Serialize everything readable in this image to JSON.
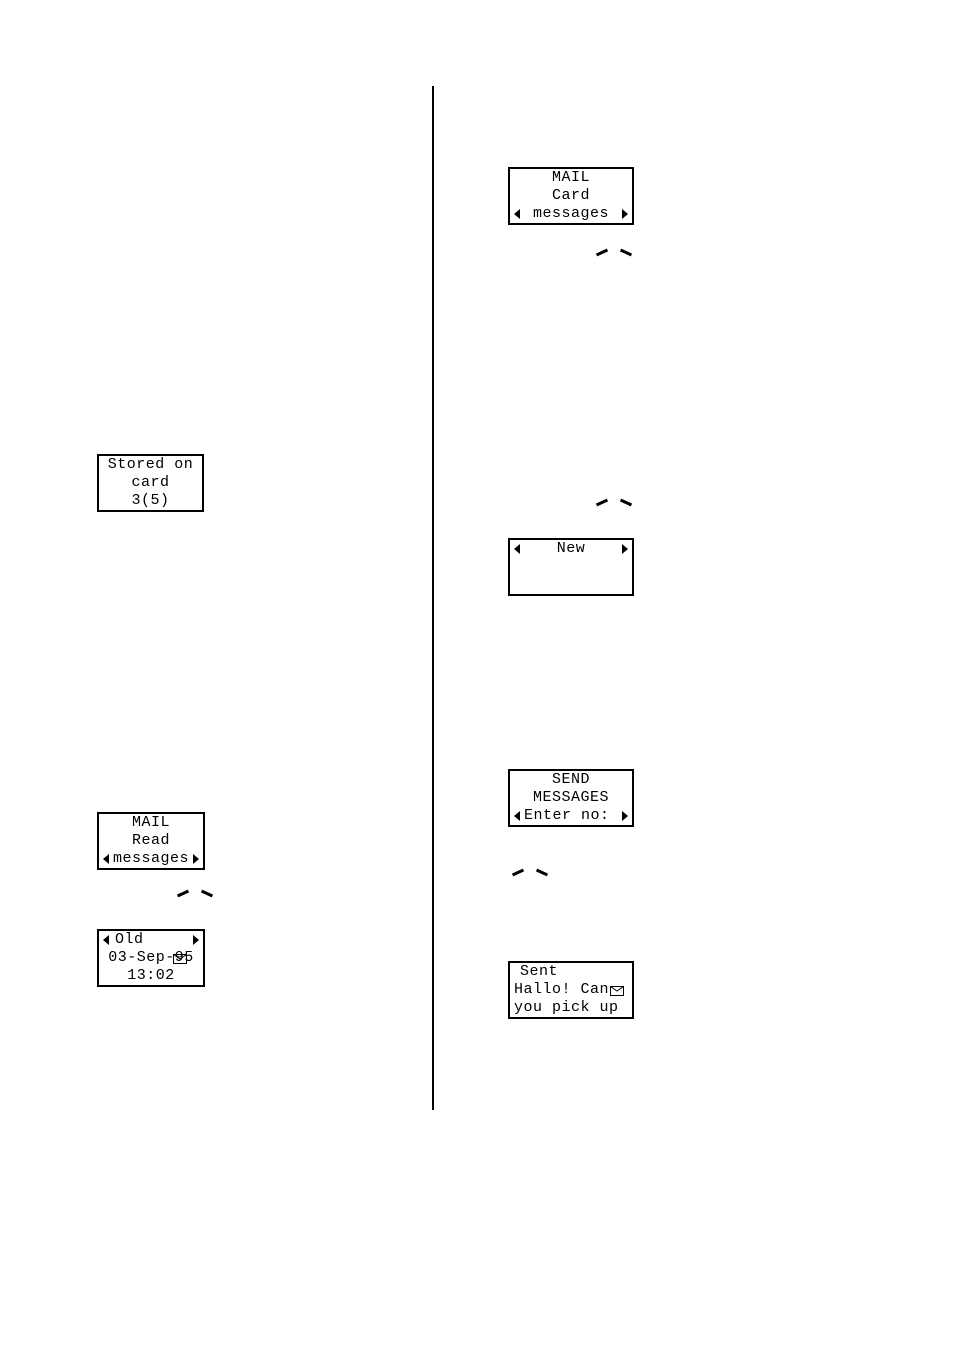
{
  "left": {
    "stored": {
      "line1": "Stored on",
      "line2": "card",
      "line3": "3(5)"
    },
    "mailRead": {
      "line1": "MAIL",
      "line2": "Read",
      "line3": "messages"
    },
    "old": {
      "line1": "Old",
      "line2": "03-Sep-95",
      "line3": "13:02"
    }
  },
  "right": {
    "mailCard": {
      "line1": "MAIL",
      "line2": "Card",
      "line3": "messages"
    },
    "new": {
      "line1": "New"
    },
    "send": {
      "line1": "SEND",
      "line2": "MESSAGES",
      "line3": "Enter no:"
    },
    "sent": {
      "line1": "Sent",
      "line2": "Hallo! Can",
      "line3": "you pick up"
    }
  }
}
